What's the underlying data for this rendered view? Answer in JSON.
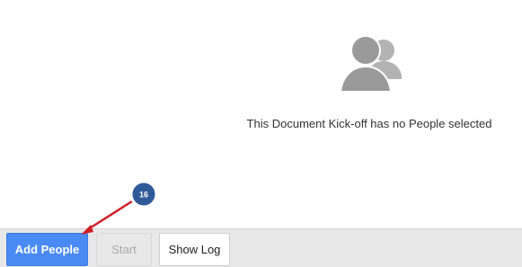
{
  "empty_state": {
    "icon": "people-icon",
    "message": "This Document Kick-off has no People selected"
  },
  "footer": {
    "add_people_label": "Add People",
    "start_label": "Start",
    "show_log_label": "Show Log"
  },
  "annotation": {
    "step_number": "16",
    "badge_color": "#2f5a9a",
    "arrow_color": "#d0202a"
  },
  "colors": {
    "primary_button": "#4a8af4",
    "footer_bg": "#e8e8e8",
    "icon_gray": "#9a9a9a"
  }
}
